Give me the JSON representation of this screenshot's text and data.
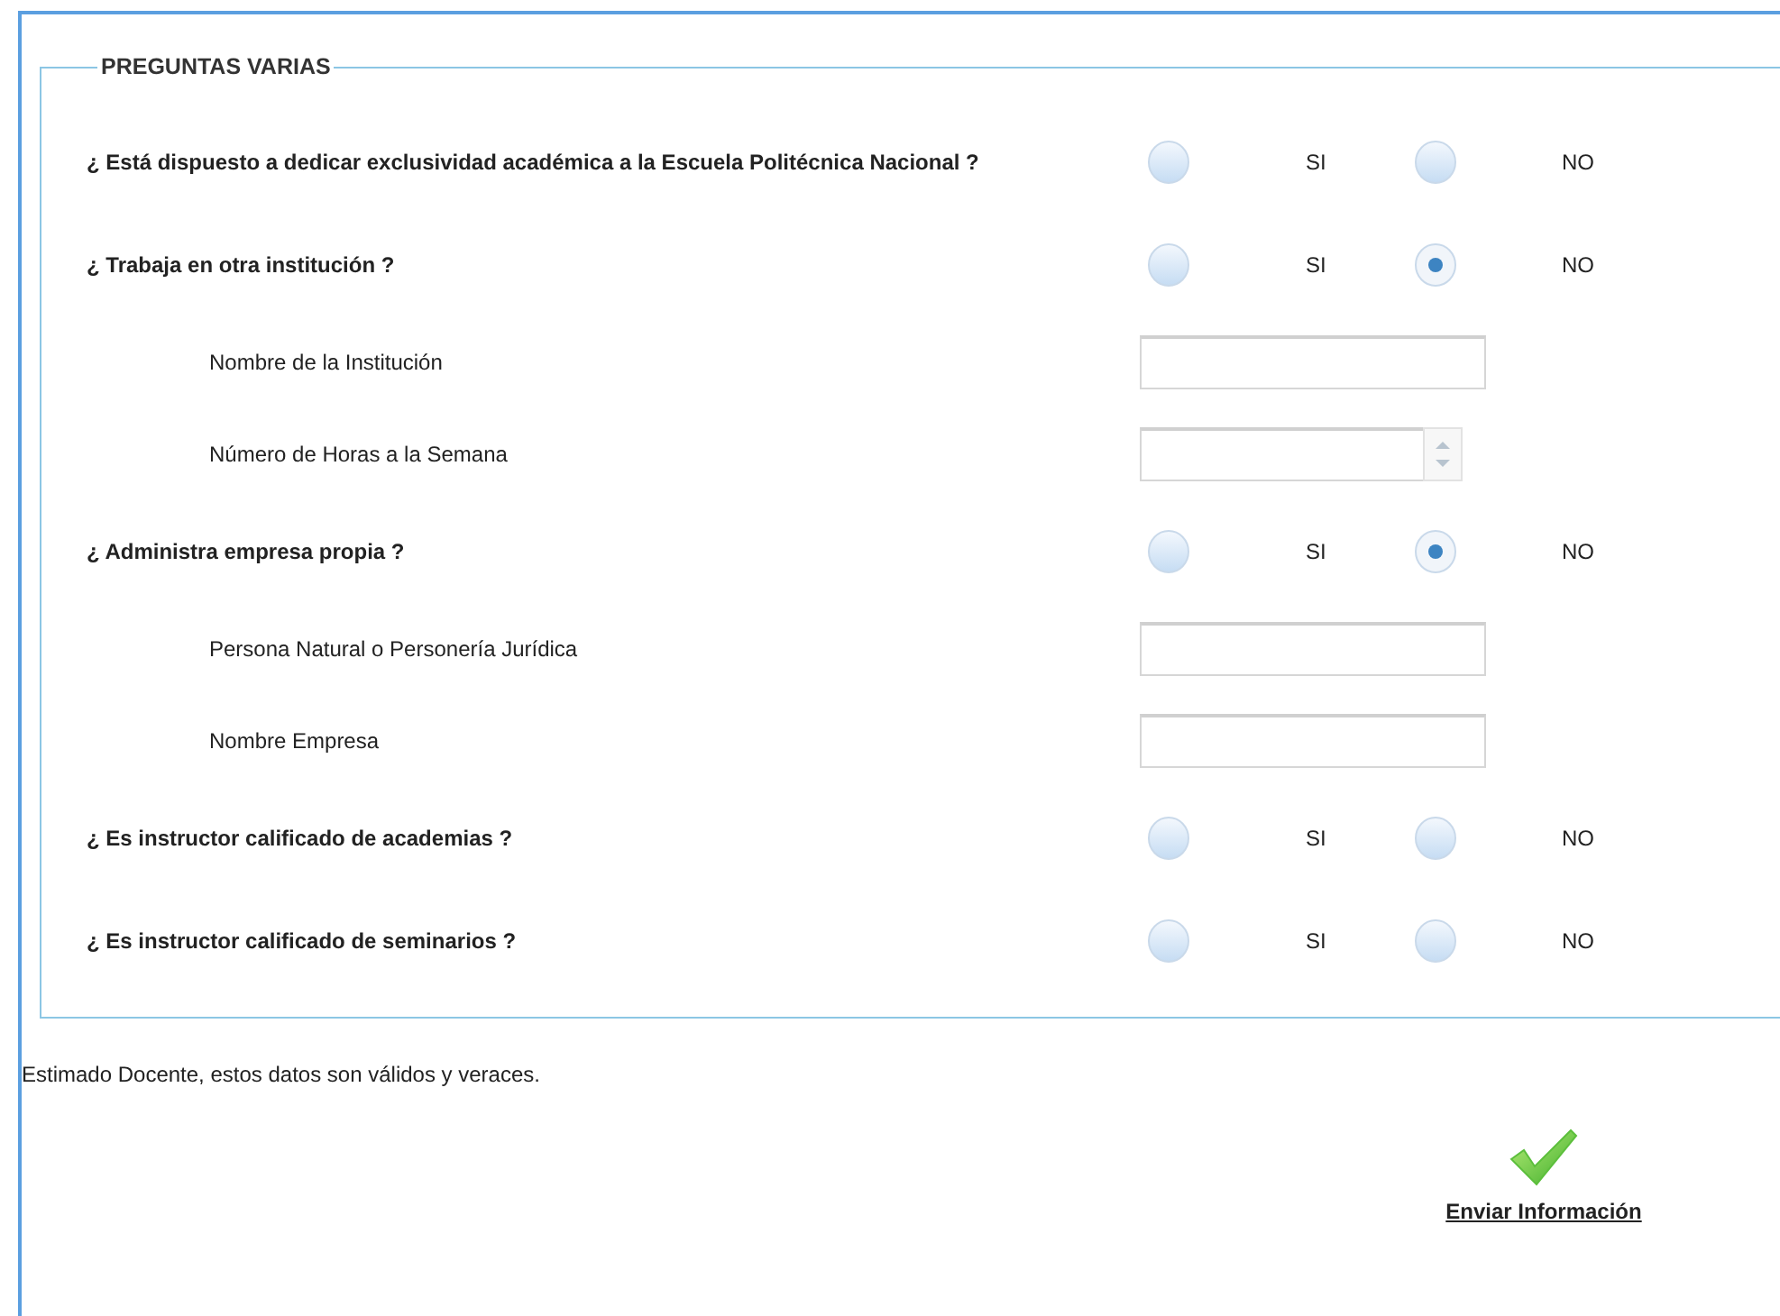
{
  "section": {
    "title": "PREGUNTAS VARIAS"
  },
  "rows": [
    {
      "kind": "question",
      "label": "¿ Está dispuesto a dedicar exclusividad académica a la Escuela Politécnica Nacional ?",
      "options": [
        {
          "label": "SI",
          "selected": false
        },
        {
          "label": "NO",
          "selected": false
        }
      ]
    },
    {
      "kind": "question",
      "label": "¿ Trabaja en otra institución ?",
      "options": [
        {
          "label": "SI",
          "selected": false
        },
        {
          "label": "NO",
          "selected": true
        }
      ]
    },
    {
      "kind": "text",
      "label": "Nombre de la Institución"
    },
    {
      "kind": "number",
      "label": "Número de Horas a la Semana"
    },
    {
      "kind": "question",
      "label": "¿ Administra empresa propia ?",
      "options": [
        {
          "label": "SI",
          "selected": false
        },
        {
          "label": "NO",
          "selected": true
        }
      ]
    },
    {
      "kind": "text",
      "label": "Persona Natural o Personería Jurídica"
    },
    {
      "kind": "text",
      "label": "Nombre Empresa"
    },
    {
      "kind": "question",
      "label": "¿ Es instructor calificado de academias ?",
      "options": [
        {
          "label": "SI",
          "selected": false
        },
        {
          "label": "NO",
          "selected": false
        }
      ]
    },
    {
      "kind": "question",
      "label": "¿ Es instructor calificado de seminarios ?",
      "options": [
        {
          "label": "SI",
          "selected": false
        },
        {
          "label": "NO",
          "selected": false
        }
      ]
    }
  ],
  "notice": "Estimado Docente, estos datos son válidos y veraces.",
  "submit": {
    "label": "Enviar Información"
  }
}
